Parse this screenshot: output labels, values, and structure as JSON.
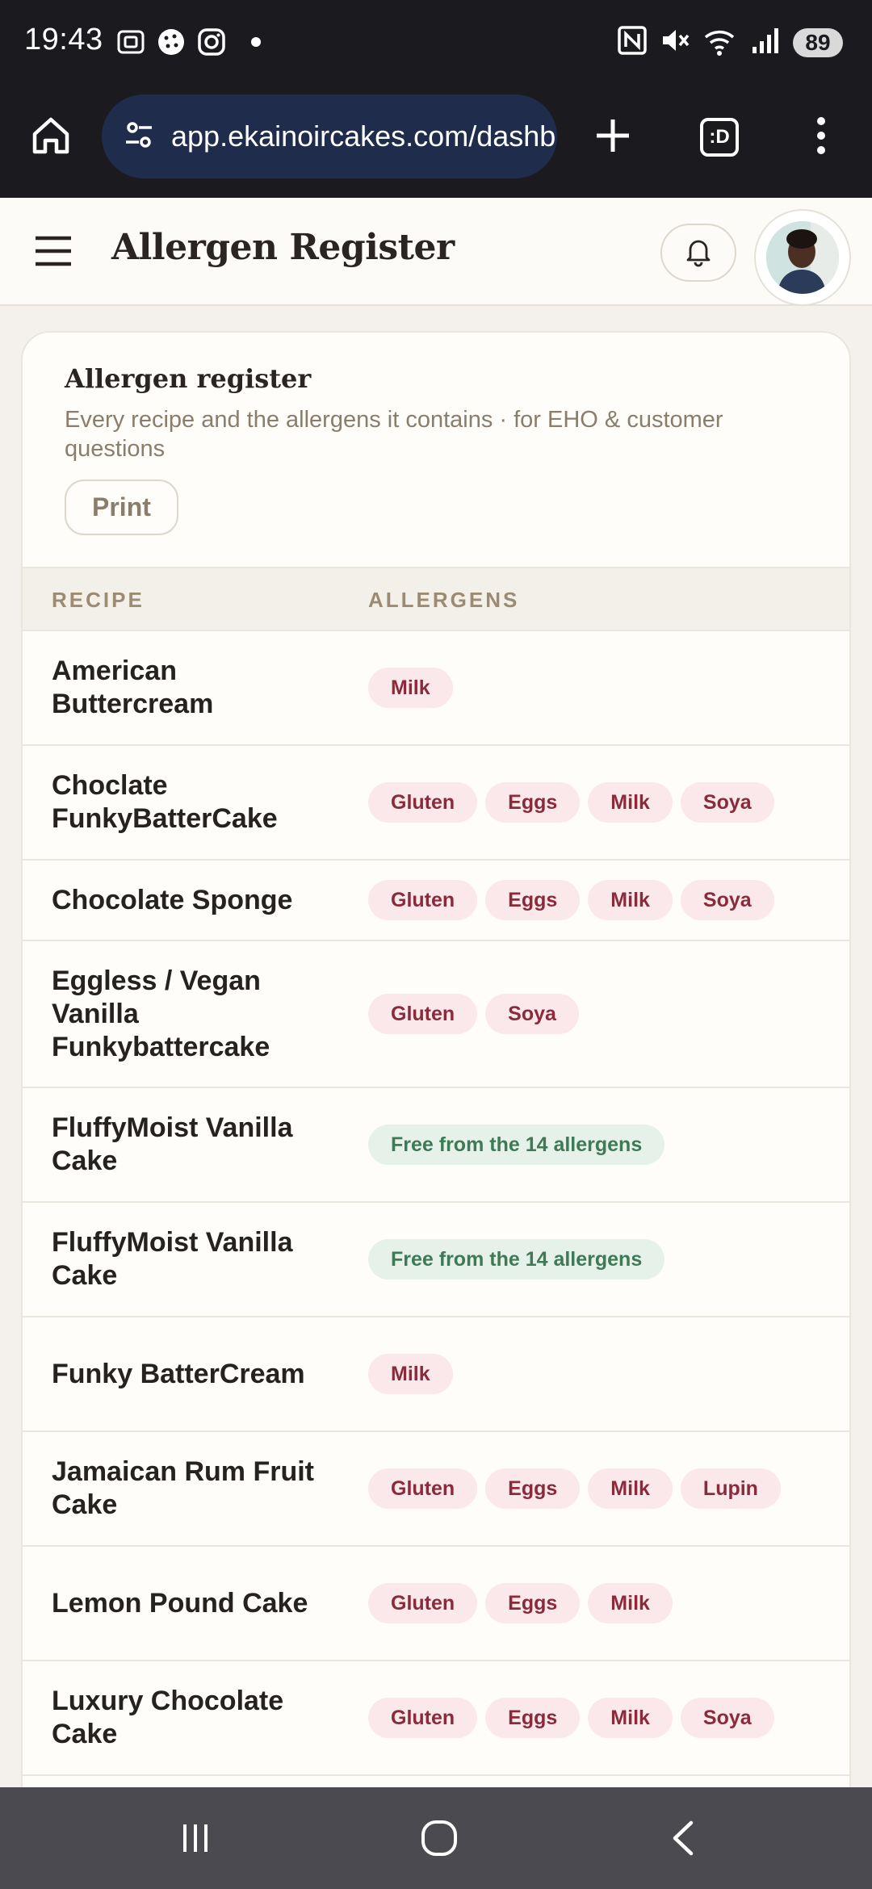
{
  "status_bar": {
    "time": "19:43",
    "battery": "89",
    "icons": [
      "screenshot-icon",
      "cookie-icon",
      "instagram-icon",
      "dot-icon",
      "nfc-icon",
      "mute-icon",
      "wifi-icon",
      "signal-icon"
    ]
  },
  "browser": {
    "url": "app.ekainoircakes.com/dashb",
    "tab_count": ":D"
  },
  "header": {
    "title": "Allergen Register"
  },
  "card": {
    "title": "Allergen register",
    "subtitle": "Every recipe and the allergens it contains · for EHO & customer questions",
    "print_label": "Print"
  },
  "table": {
    "headers": {
      "recipe": "RECIPE",
      "allergens": "ALLERGENS"
    },
    "rows": [
      {
        "name": "American Buttercream",
        "allergens": [
          "Milk"
        ]
      },
      {
        "name": "Choclate FunkyBatterCake",
        "allergens": [
          "Gluten",
          "Eggs",
          "Milk",
          "Soya"
        ]
      },
      {
        "name": "Chocolate Sponge",
        "allergens": [
          "Gluten",
          "Eggs",
          "Milk",
          "Soya"
        ]
      },
      {
        "name": "Eggless / Vegan Vanilla Funkybattercake",
        "allergens": [
          "Gluten",
          "Soya"
        ]
      },
      {
        "name": "FluffyMoist Vanilla Cake",
        "free": "Free from the 14 allergens"
      },
      {
        "name": "FluffyMoist Vanilla Cake",
        "free": "Free from the 14 allergens"
      },
      {
        "name": "Funky BatterCream",
        "allergens": [
          "Milk"
        ]
      },
      {
        "name": "Jamaican Rum Fruit Cake",
        "allergens": [
          "Gluten",
          "Eggs",
          "Milk",
          "Lupin"
        ]
      },
      {
        "name": "Lemon Pound Cake",
        "allergens": [
          "Gluten",
          "Eggs",
          "Milk"
        ]
      },
      {
        "name": "Luxury Chocolate Cake",
        "allergens": [
          "Gluten",
          "Eggs",
          "Milk",
          "Soya"
        ]
      }
    ]
  },
  "colors": {
    "allergen_chip_bg": "#fbe8ea",
    "allergen_chip_text": "#8a2b3c",
    "free_chip_bg": "#e6f1ea",
    "free_chip_text": "#3e7a55"
  }
}
